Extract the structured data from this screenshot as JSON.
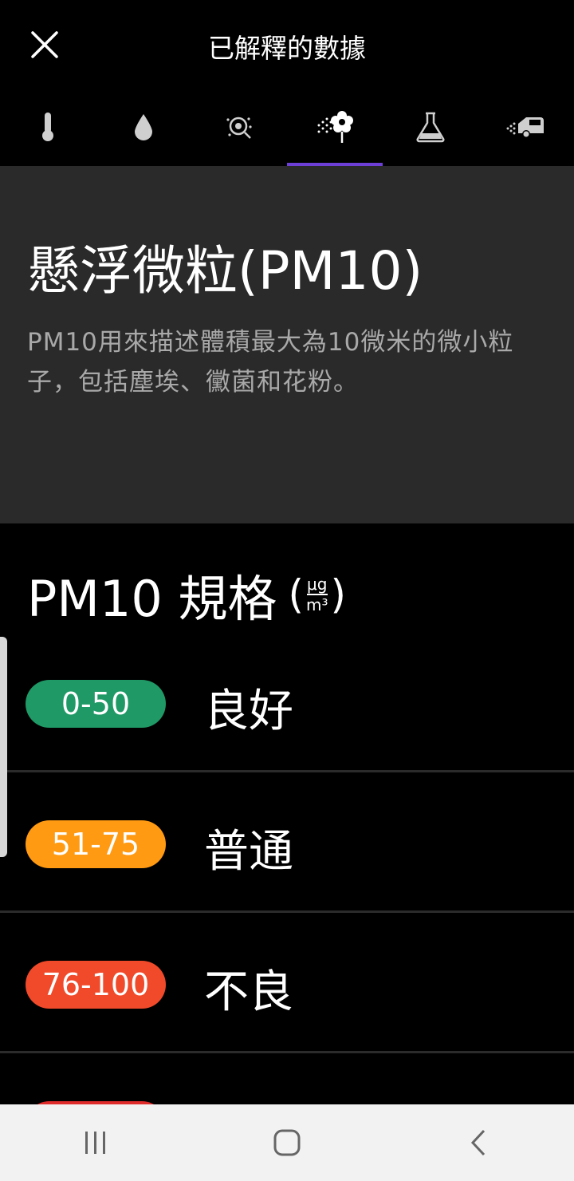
{
  "header": {
    "title": "已解釋的數據"
  },
  "tabs": [
    {
      "icon": "thermometer-icon",
      "active": false
    },
    {
      "icon": "humidity-drop-icon",
      "active": false
    },
    {
      "icon": "bacteria-icon",
      "active": false
    },
    {
      "icon": "pollen-flower-icon",
      "active": true
    },
    {
      "icon": "flask-icon",
      "active": false
    },
    {
      "icon": "car-exhaust-icon",
      "active": false
    }
  ],
  "info": {
    "title": "懸浮微粒(PM10)",
    "description": "PM10用來描述體積最大為10微米的微小粒子，包括塵埃、黴菌和花粉。"
  },
  "scale": {
    "title": "PM10 規格",
    "unit_open": "(",
    "unit_numerator": "μg",
    "unit_denominator": "m³",
    "unit_close": ")",
    "rows": [
      {
        "range": "0-50",
        "label": "良好",
        "color": "#1f9966"
      },
      {
        "range": "51-75",
        "label": "普通",
        "color": "#ff9a12"
      },
      {
        "range": "76-100",
        "label": "不良",
        "color": "#f04a2a"
      },
      {
        "range": "",
        "label": "",
        "color": "#e02b2b"
      }
    ]
  },
  "colors": {
    "accent": "#6d3fd6",
    "panel": "#2a2a2a",
    "navbar": "#f2f2f2"
  }
}
